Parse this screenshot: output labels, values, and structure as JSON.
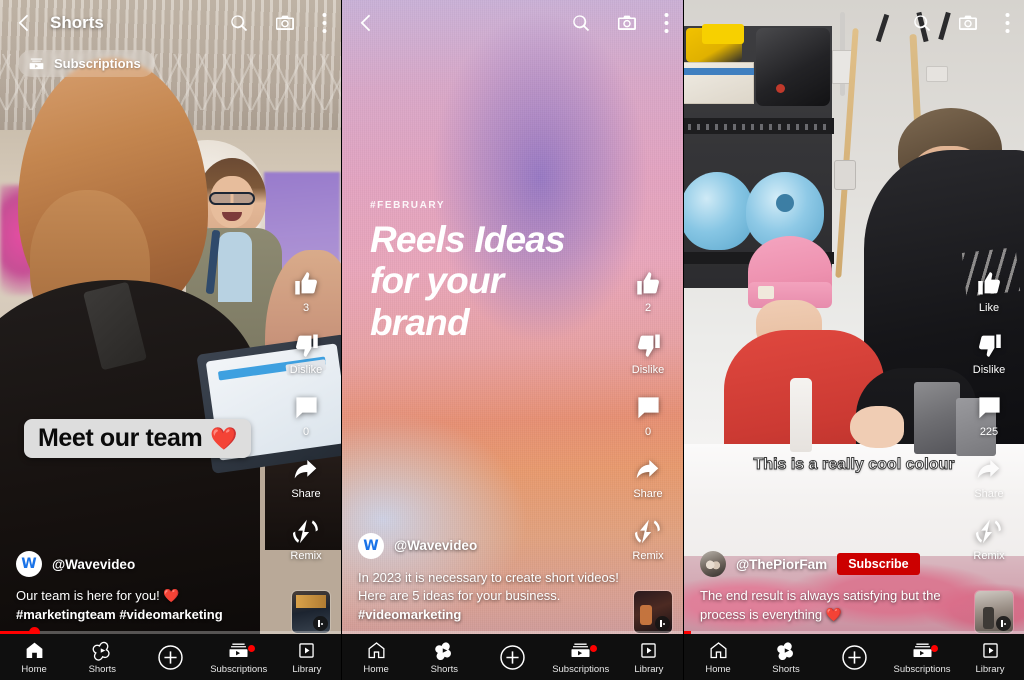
{
  "app": {
    "name": "YouTube",
    "surface": "Shorts"
  },
  "panels": [
    {
      "id": "panel-1",
      "topbar": {
        "title": "Shorts",
        "back_icon": "chevron-left-icon",
        "search_icon": "search-icon",
        "camera_icon": "camera-icon",
        "more_icon": "kebab-menu-icon"
      },
      "chip": {
        "label": "Subscriptions",
        "icon": "subscriptions-icon"
      },
      "sticker": {
        "text": "Meet our team",
        "emoji": "❤️"
      },
      "actions": {
        "like": {
          "icon": "thumbs-up-icon",
          "label": "3"
        },
        "dislike": {
          "icon": "thumbs-down-icon",
          "label": "Dislike"
        },
        "comment": {
          "icon": "comment-icon",
          "label": "0"
        },
        "share": {
          "icon": "share-arrow-icon",
          "label": "Share"
        },
        "remix": {
          "icon": "remix-icon",
          "label": "Remix"
        }
      },
      "channel": {
        "handle": "@Wavevideo",
        "avatar": "wavevideo-logo",
        "subscribe": null
      },
      "caption_line1": "Our team is here for you! ❤️",
      "caption_tags": "#marketingteam #videomarketing",
      "progress_percent": 10
    },
    {
      "id": "panel-2",
      "topbar": {
        "title": "",
        "back_icon": "chevron-left-icon",
        "search_icon": "search-icon",
        "camera_icon": "camera-icon",
        "more_icon": "kebab-menu-icon"
      },
      "graphic": {
        "kicker": "#FEBRUARY",
        "headline_line1": "Reels Ideas",
        "headline_line2": "for your",
        "headline_line3": "brand"
      },
      "actions": {
        "like": {
          "icon": "thumbs-up-icon",
          "label": "2"
        },
        "dislike": {
          "icon": "thumbs-down-icon",
          "label": "Dislike"
        },
        "comment": {
          "icon": "comment-icon",
          "label": "0"
        },
        "share": {
          "icon": "share-arrow-icon",
          "label": "Share"
        },
        "remix": {
          "icon": "remix-icon",
          "label": "Remix"
        }
      },
      "channel": {
        "handle": "@Wavevideo",
        "avatar": "wavevideo-logo",
        "subscribe": null
      },
      "caption_line1": "In 2023 it is necessary to create short videos!",
      "caption_line2": "Here are 5 ideas for your business.",
      "caption_tags": "#videomarketing",
      "progress_percent": 0
    },
    {
      "id": "panel-3",
      "topbar": {
        "title": "",
        "back_icon": "",
        "search_icon": "search-icon",
        "camera_icon": "camera-icon",
        "more_icon": "kebab-menu-icon"
      },
      "burned_caption": "This is a really cool colour",
      "actions": {
        "like": {
          "icon": "thumbs-up-icon",
          "label": "Like"
        },
        "dislike": {
          "icon": "thumbs-down-icon",
          "label": "Dislike"
        },
        "comment": {
          "icon": "comment-icon",
          "label": "225"
        },
        "share": {
          "icon": "share-arrow-icon",
          "label": "Share"
        },
        "remix": {
          "icon": "remix-icon",
          "label": "Remix"
        }
      },
      "channel": {
        "handle": "@ThePiorFam",
        "avatar": "channel-photo",
        "subscribe": "Subscribe"
      },
      "caption_line1": "The end result is always satisfying but the",
      "caption_line2": "process is everything ❤️",
      "progress_percent": 2
    }
  ],
  "bottom_nav": {
    "items": [
      {
        "label": "Home",
        "icon": "home-icon"
      },
      {
        "label": "Shorts",
        "icon": "shorts-icon"
      },
      {
        "label": "",
        "icon": "create-plus-icon"
      },
      {
        "label": "Subscriptions",
        "icon": "subscriptions-icon",
        "badge": true
      },
      {
        "label": "Library",
        "icon": "library-icon"
      }
    ]
  },
  "colors": {
    "accent_red": "#ff0000",
    "subscribe_red": "#cc0000",
    "nav_background": "#0f0f0f",
    "wave_blue": "#1a73e8"
  }
}
